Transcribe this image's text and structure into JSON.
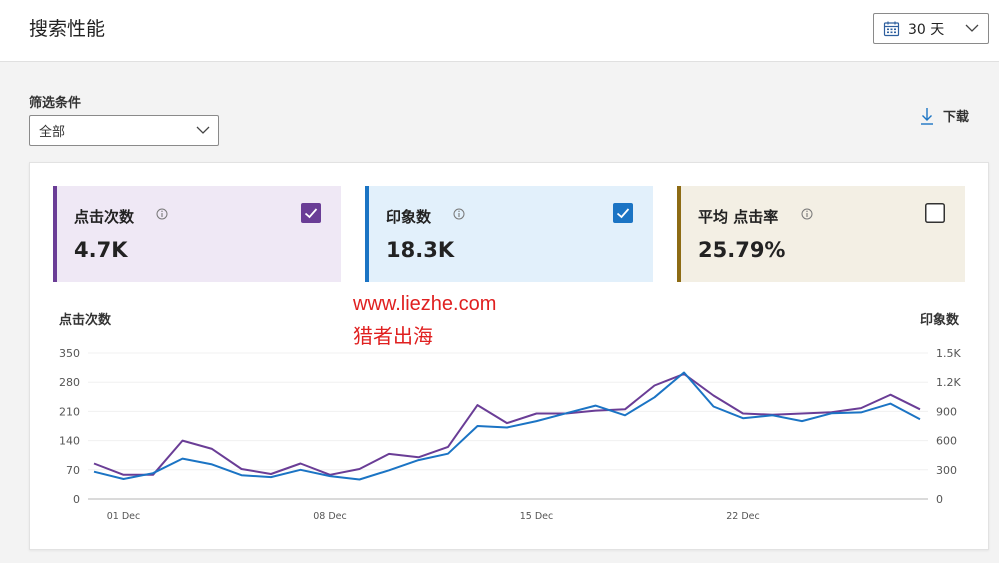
{
  "header": {
    "title": "搜索性能",
    "range_label": "30 天"
  },
  "filter": {
    "label": "筛选条件",
    "value": "全部"
  },
  "toolbar": {
    "download_label": "下载"
  },
  "metrics": [
    {
      "label": "点击次数",
      "value": "4.7K",
      "checked": true,
      "color": "#6a3d96",
      "bg": "#efe8f5"
    },
    {
      "label": "印象数",
      "value": "18.3K",
      "checked": true,
      "color": "#1b74c4",
      "bg": "#e2f0fb"
    },
    {
      "label": "平均 点击率",
      "value": "25.79%",
      "checked": false,
      "color": "#8d6b14",
      "bg": "#f3efe4"
    }
  ],
  "watermark": {
    "line1": "www.liezhe.com",
    "line2": "猎者出海"
  },
  "chart_data": {
    "type": "line",
    "left_axis_title": "点击次数",
    "right_axis_title": "印象数",
    "x_tick_labels": [
      "01 Dec",
      "08 Dec",
      "15 Dec",
      "22 Dec"
    ],
    "x_tick_index": [
      1,
      8,
      15,
      22
    ],
    "y_left_ticks": [
      "0",
      "70",
      "140",
      "210",
      "280",
      "350"
    ],
    "y_right_ticks": [
      "0",
      "300",
      "600",
      "900",
      "1.2K",
      "1.5K"
    ],
    "ylim_left": [
      0,
      350
    ],
    "ylim_right": [
      0,
      1500
    ],
    "series": [
      {
        "name": "点击次数",
        "axis": "left",
        "color": "#6a3d96",
        "values": [
          85,
          58,
          58,
          140,
          120,
          72,
          60,
          85,
          58,
          72,
          108,
          100,
          125,
          225,
          182,
          205,
          205,
          212,
          215,
          272,
          300,
          248,
          205,
          202,
          205,
          208,
          218,
          250,
          215
        ]
      },
      {
        "name": "印象数",
        "axis": "right",
        "color": "#1b74c4",
        "values": [
          280,
          205,
          265,
          415,
          355,
          245,
          225,
          300,
          235,
          200,
          295,
          400,
          465,
          750,
          735,
          800,
          880,
          960,
          860,
          1045,
          1300,
          950,
          830,
          860,
          800,
          880,
          890,
          980,
          820
        ]
      }
    ]
  }
}
